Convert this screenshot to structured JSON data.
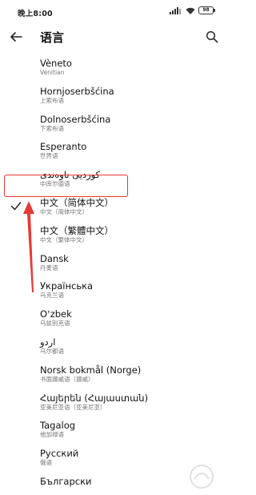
{
  "status_bar": {
    "time": "晚上8:00",
    "battery": "98"
  },
  "header": {
    "title": "语言"
  },
  "languages": [
    {
      "name": "Vèneto",
      "sub": "Venitian",
      "selected": false
    },
    {
      "name": "Hornjoserbšćina",
      "sub": "上索布语",
      "selected": false
    },
    {
      "name": "Dolnoserbšćina",
      "sub": "下索布语",
      "selected": false
    },
    {
      "name": "Esperanto",
      "sub": "世界语",
      "selected": false
    },
    {
      "name": "کوردیی ناوەندی",
      "sub": "中库尔德语",
      "selected": false
    },
    {
      "name": "中文（简体中文）",
      "sub": "中文（简体中文）",
      "selected": true
    },
    {
      "name": "中文（繁體中文）",
      "sub": "中文（繁体中文）",
      "selected": false
    },
    {
      "name": "Dansk",
      "sub": "丹麦语",
      "selected": false
    },
    {
      "name": "Українська",
      "sub": "乌克兰语",
      "selected": false
    },
    {
      "name": "Oʻzbek",
      "sub": "乌兹别克语",
      "selected": false
    },
    {
      "name": "اردو",
      "sub": "乌尔都语",
      "selected": false
    },
    {
      "name": "Norsk bokmål (Norge)",
      "sub": "书面挪威语（挪威）",
      "selected": false
    },
    {
      "name": "Հայերեն (Հայաստան)",
      "sub": "亚美尼亚语（亚美尼亚）",
      "selected": false
    },
    {
      "name": "Tagalog",
      "sub": "他加禄语",
      "selected": false
    },
    {
      "name": "Русский",
      "sub": "俄语",
      "selected": false
    },
    {
      "name": "Български",
      "sub": "",
      "selected": false
    }
  ],
  "colors": {
    "highlight": "#e53935",
    "text_primary": "#111111",
    "text_secondary": "#777777"
  },
  "icons": {
    "back": "arrow-left-icon",
    "search": "search-icon",
    "check": "check-icon"
  }
}
